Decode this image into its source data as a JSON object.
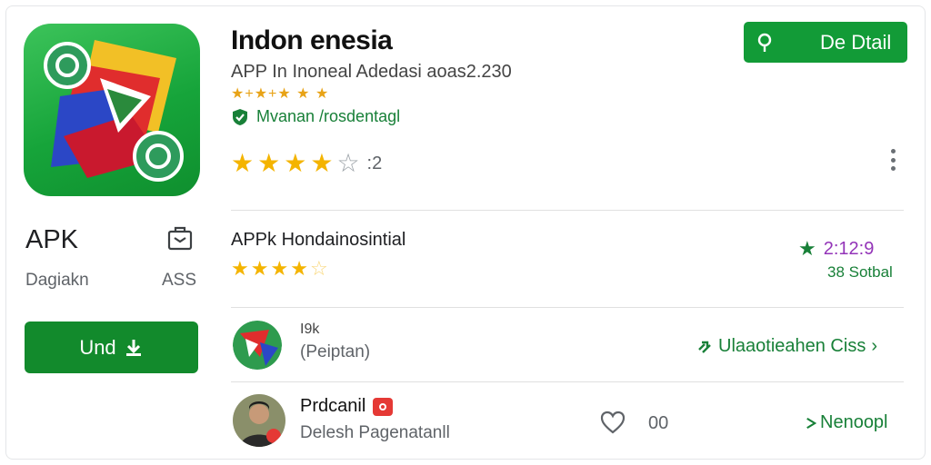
{
  "app": {
    "title": "Indon enesia",
    "subtitle": "APP In Inoneal Adedasi aoas2.230",
    "mini_rating_stars": "★+★+★ ★ ★",
    "verified_text": "Mvanan /rosdentagl",
    "rating_count": ":2",
    "rating_value": 4,
    "rating_max": 5
  },
  "left_panel": {
    "apk_label": "APK",
    "developer_label": "Dagiakn",
    "size_label": "ASS",
    "install_button": "Und"
  },
  "header": {
    "detail_button": "De Dtail"
  },
  "row1": {
    "title": "APPk Hondainosintial",
    "stars_value": 4.5,
    "score_text": "2:12:9",
    "score_subtext": "38 Sotbal"
  },
  "row2": {
    "name": "I9k",
    "subtitle": "(Peiptan)",
    "link_text": "Ulaaotieahen Ciss",
    "link_chevron": "›"
  },
  "row3": {
    "name": "Prdcanil",
    "subtitle": "Delesh Pagenatanll",
    "like_count": "00",
    "link_text": "Nenoopl"
  },
  "colors": {
    "primary_green": "#128a2c",
    "button_green": "#129b37",
    "link_green": "#188038",
    "star_gold": "#f4b400",
    "score_purple": "#9334b8",
    "badge_red": "#e53935"
  },
  "icons": {
    "share": "share-box-icon",
    "download": "download-icon",
    "pin": "location-pin-icon",
    "verified": "shield-check-icon",
    "more": "kebab-menu-icon",
    "heart": "heart-outline-icon",
    "play": "play-triangle-icon",
    "trophy": "star-icon"
  }
}
